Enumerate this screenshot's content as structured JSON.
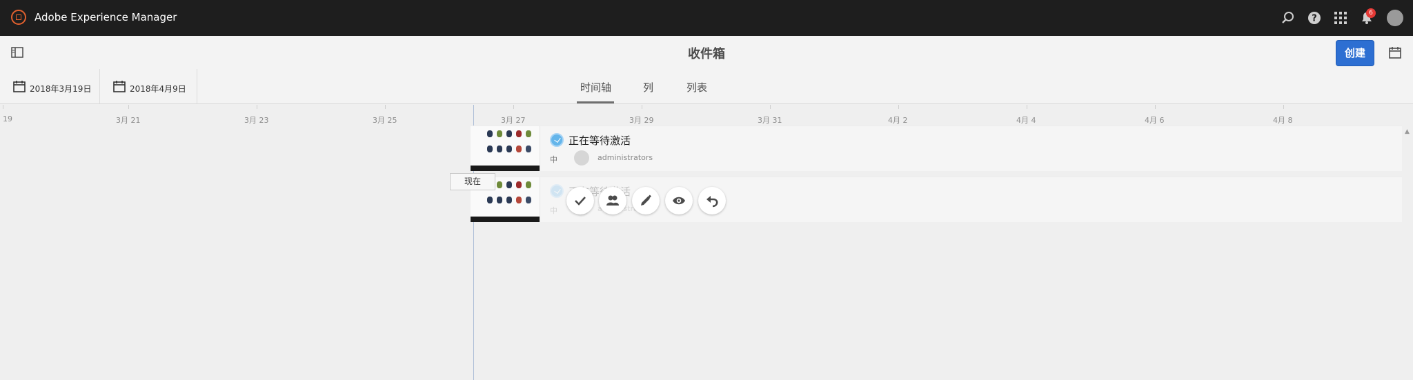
{
  "shell": {
    "app_title": "Adobe Experience Manager",
    "notification_count": "6",
    "brand_color": "#e1602e",
    "icons": [
      "search-icon",
      "help-icon",
      "apps-grid-icon",
      "notifications-bell-icon",
      "user-avatar"
    ]
  },
  "actionbar": {
    "title": "收件箱",
    "create_label": "创建",
    "accent": "#2d6fd2"
  },
  "toolbar": {
    "start_date": "2018年3月19日",
    "end_date": "2018年4月9日",
    "tabs": [
      {
        "label": "时间轴",
        "selected": true
      },
      {
        "label": "列",
        "selected": false
      },
      {
        "label": "列表",
        "selected": false
      }
    ]
  },
  "timeline": {
    "ticks": [
      "19",
      "3月 21",
      "3月 23",
      "3月 25",
      "3月 27",
      "3月 29",
      "3月 31",
      "4月 2",
      "4月 4",
      "4月 6",
      "4月 8"
    ],
    "now_label": "现在",
    "items": [
      {
        "status": "正在等待激活",
        "priority": "中",
        "assignee": "administrators"
      },
      {
        "status": "正在等待激活",
        "priority": "中",
        "assignee": "administrators"
      }
    ]
  },
  "quick_actions": [
    "check-icon",
    "delegate-icon",
    "edit-icon",
    "view-icon",
    "undo-icon"
  ]
}
